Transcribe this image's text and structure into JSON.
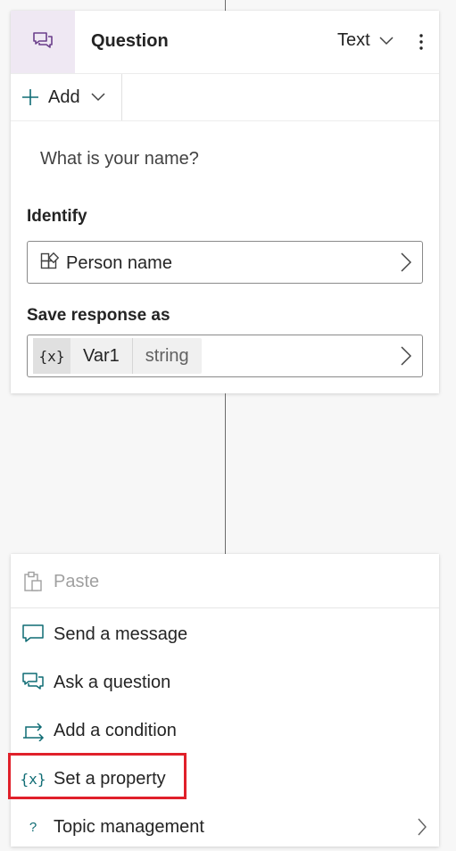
{
  "question_card": {
    "title": "Question",
    "type_label": "Text",
    "add_label": "Add",
    "prompt": "What is your name?",
    "identify_label": "Identify",
    "identify_value": "Person name",
    "save_label": "Save response as",
    "variable": {
      "badge": "{x}",
      "name": "Var1",
      "type": "string"
    }
  },
  "add_menu": {
    "items": [
      {
        "label": "Paste",
        "icon": "clipboard-icon",
        "disabled": true
      },
      {
        "label": "Send a message",
        "icon": "message-icon"
      },
      {
        "label": "Ask a question",
        "icon": "question-bubbles-icon"
      },
      {
        "label": "Add a condition",
        "icon": "branch-icon"
      },
      {
        "label": "Set a property",
        "icon": "variable-icon",
        "highlighted": true
      },
      {
        "label": "Topic management",
        "icon": "question-mark-icon",
        "has_submenu": true
      }
    ],
    "variable_glyph": "{x}",
    "topic_glyph": "?"
  },
  "colors": {
    "accent": "#0f6c74",
    "card_icon_bg": "#efe8f3",
    "question_icon": "#6b3f8b",
    "highlight": "#e0202a"
  }
}
